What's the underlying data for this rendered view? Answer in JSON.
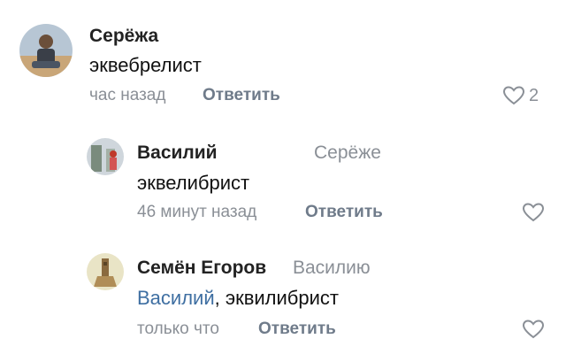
{
  "comments": [
    {
      "author": "Серёжа",
      "text": "эквебрелист",
      "time": "час назад",
      "reply_label": "Ответить",
      "likes": "2",
      "avatar": "photo-avatar"
    },
    {
      "author": "Василий",
      "reply_to": "Серёже",
      "text": "эквелибрист",
      "time": "46 минут назад",
      "reply_label": "Ответить",
      "avatar": "photo-avatar"
    },
    {
      "author": "Семён Егоров",
      "reply_to": "Василию",
      "mention": "Василий",
      "text": ", эквилибрист",
      "time": "только что",
      "reply_label": "Ответить",
      "avatar": "photo-avatar"
    }
  ],
  "icons": {
    "like": "heart-outline-icon"
  },
  "colors": {
    "name": "#222222",
    "muted": "#8a8f96",
    "reply": "#6f7b8a",
    "mention": "#3f6fa2"
  }
}
